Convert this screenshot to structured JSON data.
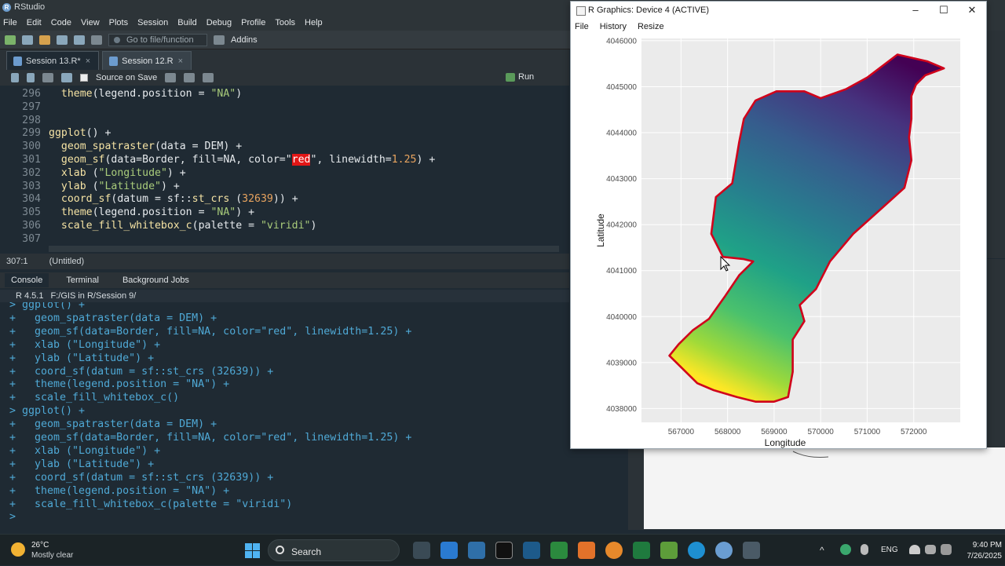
{
  "app": {
    "title": "RStudio"
  },
  "menu": [
    "File",
    "Edit",
    "Code",
    "View",
    "Plots",
    "Session",
    "Build",
    "Debug",
    "Profile",
    "Tools",
    "Help"
  ],
  "toolbar": {
    "goto_placeholder": "Go to file/function",
    "addins": "Addins"
  },
  "editor": {
    "tabs": [
      {
        "label": "Session 13.R*"
      },
      {
        "label": "Session 12.R"
      }
    ],
    "source_on_save": "Source on Save",
    "run": "Run",
    "status_pos": "307:1",
    "status_scope": "(Untitled)",
    "lines": [
      {
        "n": "296",
        "code": "  theme(legend.position = \"NA\")"
      },
      {
        "n": "297",
        "code": ""
      },
      {
        "n": "298",
        "code": ""
      },
      {
        "n": "299",
        "code": "ggplot() +"
      },
      {
        "n": "300",
        "code": "  geom_spatraster(data = DEM) +"
      },
      {
        "n": "301",
        "code": "  geom_sf(data=Border, fill=NA, color=\"red\", linewidth=1.25) +"
      },
      {
        "n": "302",
        "code": "  xlab (\"Longitude\") +"
      },
      {
        "n": "303",
        "code": "  ylab (\"Latitude\") +"
      },
      {
        "n": "304",
        "code": "  coord_sf(datum = sf::st_crs (32639)) +"
      },
      {
        "n": "305",
        "code": "  theme(legend.position = \"NA\") +"
      },
      {
        "n": "306",
        "code": "  scale_fill_whitebox_c(palette = \"viridi\")"
      },
      {
        "n": "307",
        "code": ""
      }
    ]
  },
  "console": {
    "tabs": [
      "Console",
      "Terminal",
      "Background Jobs"
    ],
    "version": "R 4.5.1",
    "path": "F:/GIS in R/Session 9/",
    "lines": [
      "> ggplot() +",
      "+   geom_spatraster(data = DEM) +",
      "+   geom_sf(data=Border, fill=NA, color=\"red\", linewidth=1.25) +",
      "+   xlab (\"Longitude\") +",
      "+   ylab (\"Latitude\") +",
      "+   coord_sf(datum = sf::st_crs (32639)) +",
      "+   theme(legend.position = \"NA\") +",
      "+   scale_fill_whitebox_c()",
      "> ggplot() +",
      "+   geom_spatraster(data = DEM) +",
      "+   geom_sf(data=Border, fill=NA, color=\"red\", linewidth=1.25) +",
      "+   xlab (\"Longitude\") +",
      "+   ylab (\"Latitude\") +",
      "+   coord_sf(datum = sf::st_crs (32639)) +",
      "+   theme(legend.position = \"NA\") +",
      "+   scale_fill_whitebox_c(palette = \"viridi\")",
      "> "
    ]
  },
  "rwindow": {
    "title": "R Graphics: Device 4 (ACTIVE)",
    "menu": [
      "File",
      "History",
      "Resize"
    ],
    "controls": [
      "–",
      "☐",
      "✕"
    ]
  },
  "chart_data": {
    "type": "heatmap",
    "title": "",
    "xlabel": "Longitude",
    "ylabel": "Latitude",
    "x_ticks": [
      "567000",
      "568000",
      "569000",
      "570000",
      "571000",
      "572000"
    ],
    "y_ticks": [
      "4038000",
      "4039000",
      "4040000",
      "4041000",
      "4042000",
      "4043000",
      "4044000",
      "4045000",
      "4046000"
    ],
    "xlim": [
      566150,
      573000
    ],
    "ylim": [
      4037700,
      4046050
    ],
    "palette": "viridis",
    "border_color": "#d0021b",
    "border": [
      [
        571650,
        4045700
      ],
      [
        572300,
        4045550
      ],
      [
        572650,
        4045400
      ],
      [
        572250,
        4045250
      ],
      [
        572050,
        4045050
      ],
      [
        571950,
        4044800
      ],
      [
        571950,
        4044300
      ],
      [
        571900,
        4043900
      ],
      [
        571950,
        4043400
      ],
      [
        571800,
        4042800
      ],
      [
        571250,
        4042300
      ],
      [
        570700,
        4041800
      ],
      [
        570200,
        4041200
      ],
      [
        569900,
        4040600
      ],
      [
        569550,
        4040250
      ],
      [
        569650,
        4039900
      ],
      [
        569400,
        4039500
      ],
      [
        569400,
        4038800
      ],
      [
        569300,
        4038250
      ],
      [
        569000,
        4038150
      ],
      [
        568600,
        4038150
      ],
      [
        568200,
        4038250
      ],
      [
        567700,
        4038400
      ],
      [
        567350,
        4038550
      ],
      [
        567100,
        4038800
      ],
      [
        566750,
        4039150
      ],
      [
        566950,
        4039400
      ],
      [
        567250,
        4039700
      ],
      [
        567600,
        4039950
      ],
      [
        567950,
        4040450
      ],
      [
        568250,
        4040900
      ],
      [
        568550,
        4041200
      ],
      [
        568350,
        4041250
      ],
      [
        567900,
        4041300
      ],
      [
        567650,
        4041800
      ],
      [
        567750,
        4042600
      ],
      [
        568100,
        4042900
      ],
      [
        568250,
        4043800
      ],
      [
        568350,
        4044300
      ],
      [
        568600,
        4044700
      ],
      [
        569050,
        4044900
      ],
      [
        569650,
        4044900
      ],
      [
        570000,
        4044750
      ],
      [
        570550,
        4044950
      ],
      [
        571000,
        4045200
      ],
      [
        571650,
        4045700
      ]
    ]
  },
  "taskbar": {
    "temp": "26°C",
    "weather": "Mostly clear",
    "search": "Search",
    "lang": "ENG",
    "time": "9:40 PM",
    "date": "7/26/2025"
  }
}
